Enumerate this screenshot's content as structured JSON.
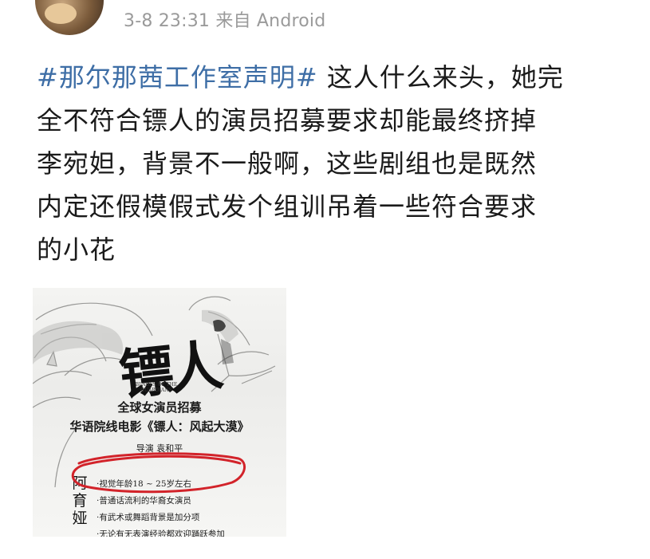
{
  "post": {
    "timestamp": "3-8 23:31",
    "source": "来自 Android",
    "hashtag": "#那尔那茜工作室声明#",
    "lines": [
      " 这人什么来头，她完",
      "全不符合镖人的演员招募要求却能最终挤掉",
      "李宛妲，背景不一般啊，这些剧组也是既然",
      "内定还假模假式发个组训吊着一些符合要求",
      "的小花"
    ]
  },
  "poster": {
    "title": "镖人",
    "title_en": "BLADES OF THE GUARDIANS",
    "headline": "全球女演员招募",
    "subtitle": "华语院线电影《镖人：风起大漠》",
    "director": "导演  袁和平",
    "requirements": [
      "·视觉年龄18 ~ 25岁左右",
      "·普通话流利的华裔女演员",
      "·有武术或舞蹈背景是加分项",
      "·无论有无表演经验都欢迎踊跃参加"
    ],
    "side_name": [
      "阿",
      "育",
      "娅"
    ]
  },
  "colors": {
    "hashtag": "#3e6ea6",
    "meta": "#9a9a9a",
    "circle": "#d2232a"
  }
}
